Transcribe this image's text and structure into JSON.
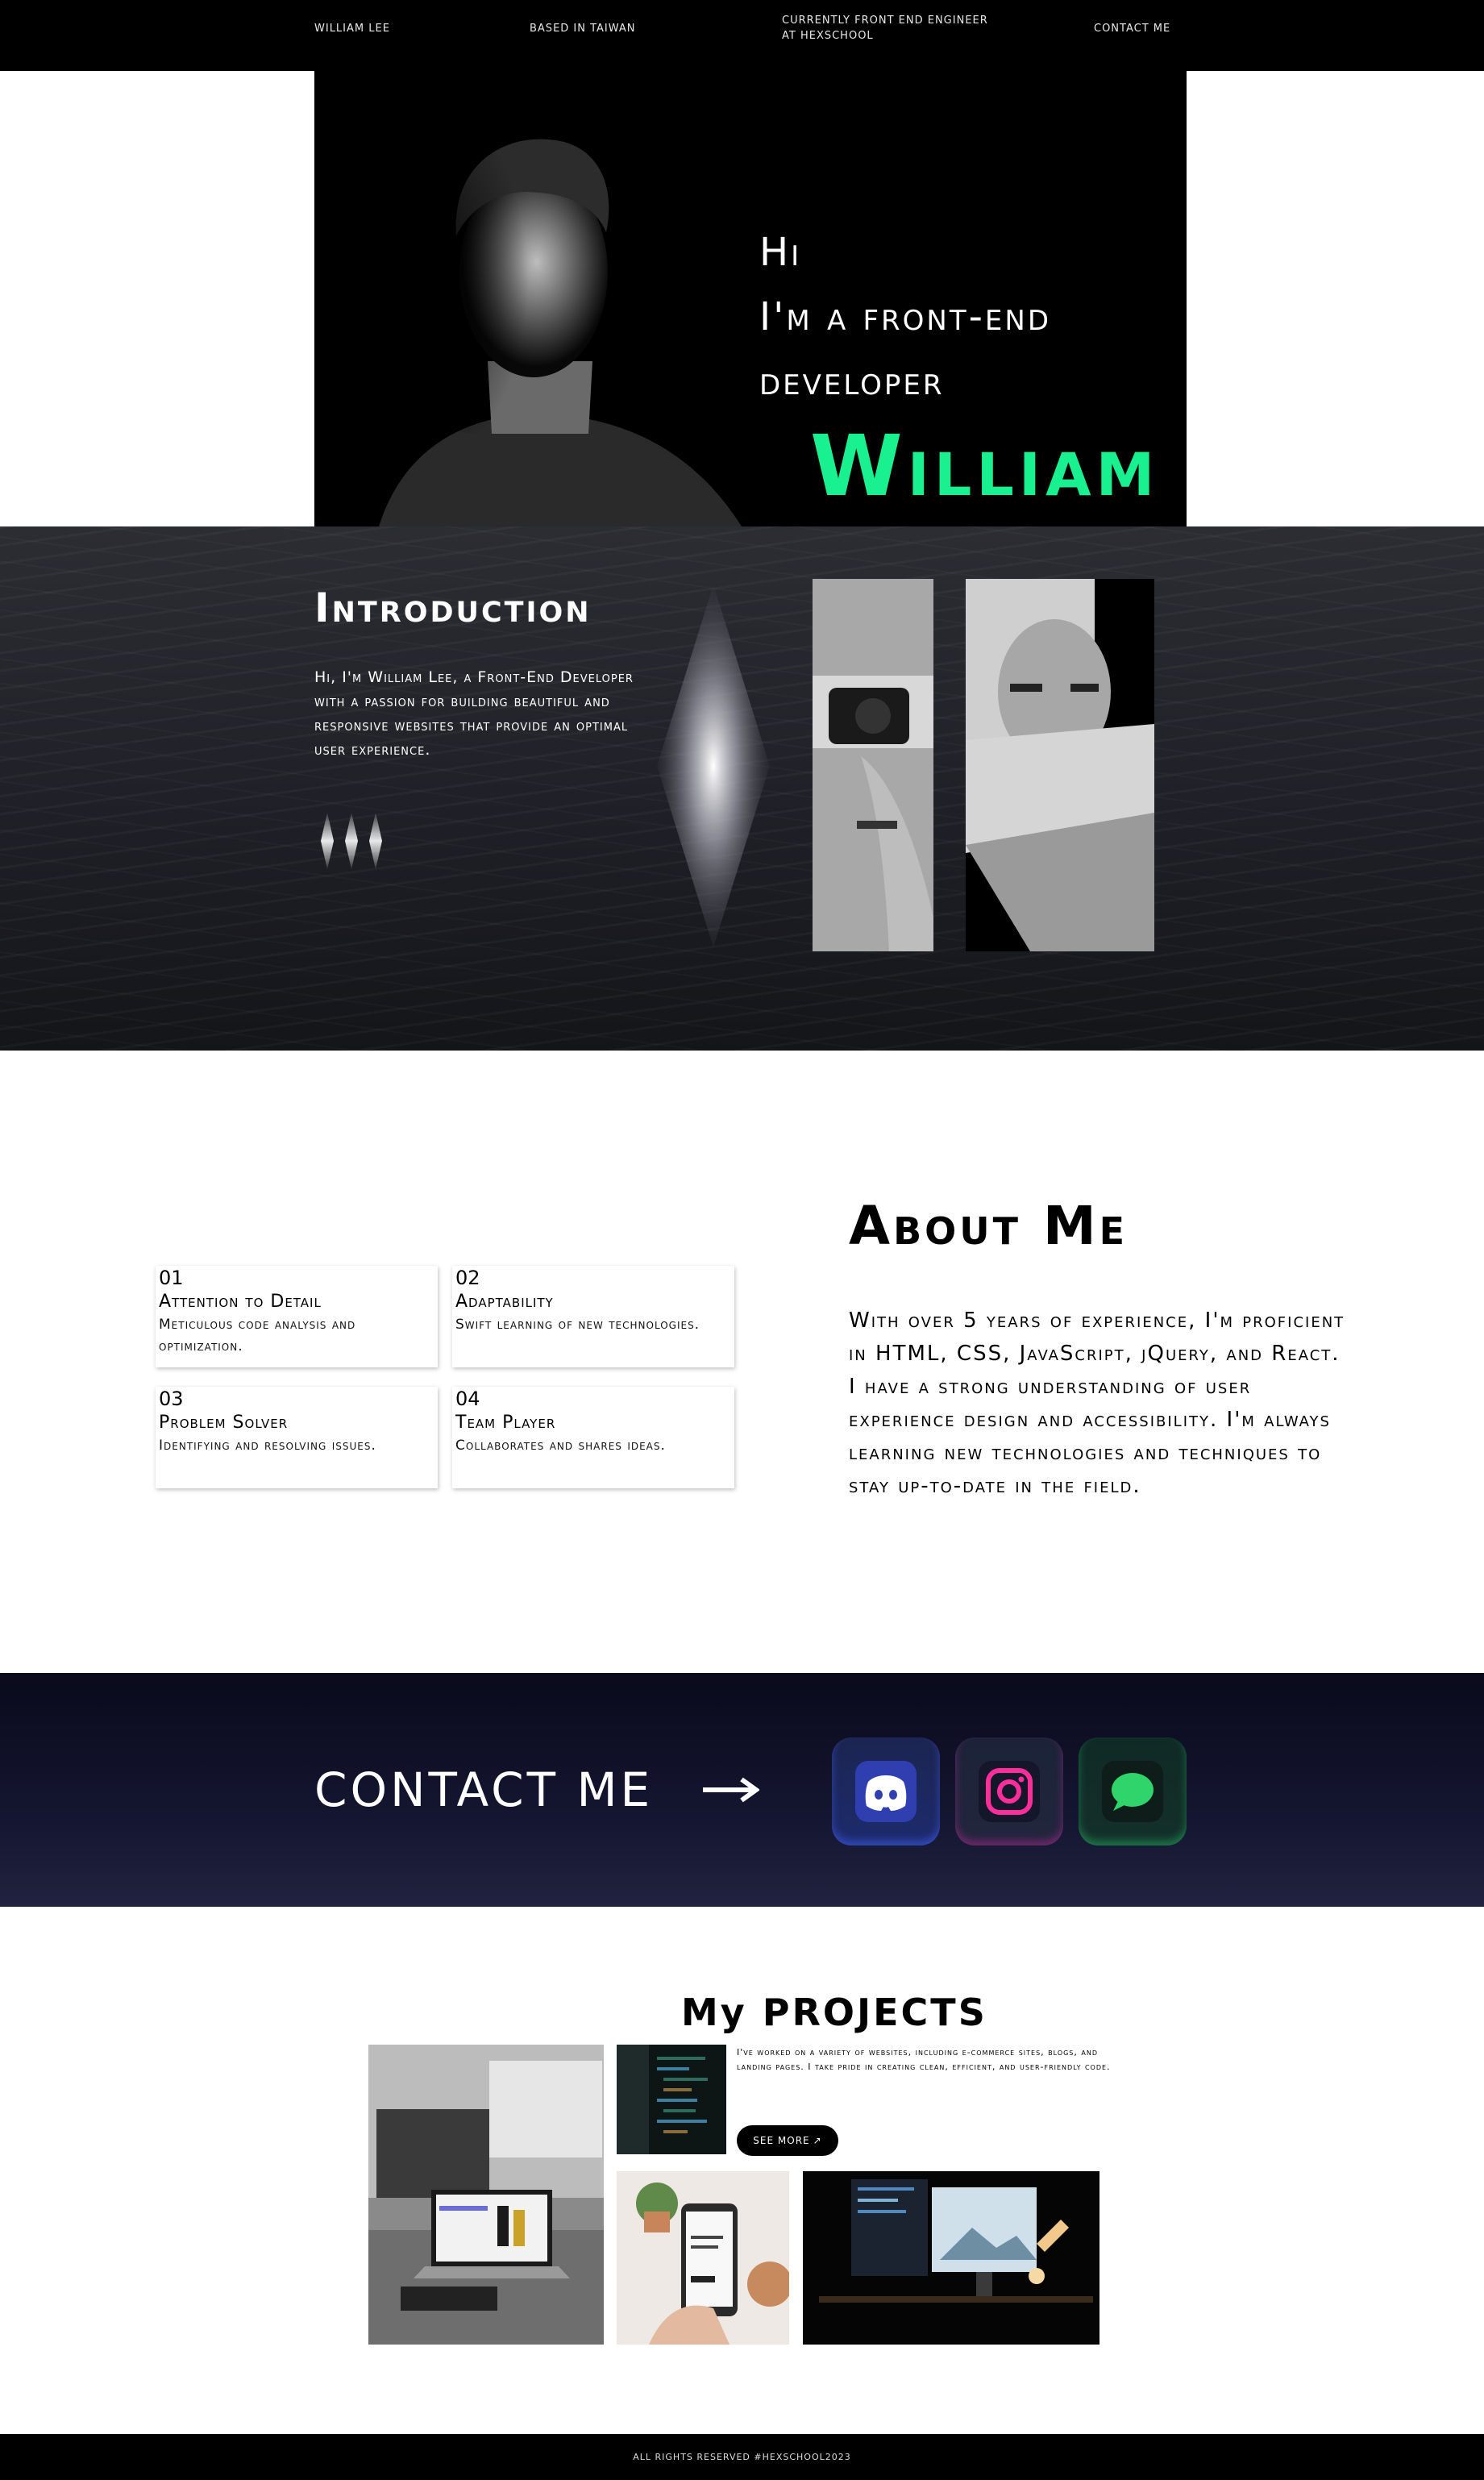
{
  "nav": {
    "name": "WILLIAM LEE",
    "location": "BASED IN TAIWAN",
    "role": "CURRENTLY FRONT END ENGINEER AT HEXSCHOOL",
    "contact": "CONTACT ME"
  },
  "hero": {
    "line1": "Hi",
    "line2": "I'm a front-end",
    "line3": "developer",
    "name": "William",
    "accent_color": "#19f08f"
  },
  "intro": {
    "title": "Introduction",
    "body": "Hi, I'm William Lee, a Front-End Developer with a passion for building beautiful and responsive websites that provide an optimal user experience."
  },
  "about": {
    "title": "About Me",
    "body": "With over 5 years of experience, I'm proficient in HTML, CSS, JavaScript, jQuery, and React. I have a strong understanding of user experience design and accessibility. I'm always learning new technologies and techniques to stay up-to-date in the field.",
    "cards": [
      {
        "num": "01",
        "title": "Attention to Detail",
        "desc": "Meticulous code analysis and optimization."
      },
      {
        "num": "02",
        "title": "Adaptability",
        "desc": "Swift learning of new technologies."
      },
      {
        "num": "03",
        "title": "Problem Solver",
        "desc": "Identifying and resolving issues."
      },
      {
        "num": "04",
        "title": "Team Player",
        "desc": "Collaborates and shares ideas."
      }
    ]
  },
  "contact": {
    "label": "CONTACT ME",
    "icons": [
      "discord-icon",
      "instagram-icon",
      "message-icon"
    ]
  },
  "projects": {
    "title": "My PROJECTS",
    "desc": "I've worked on a variety of websites, including e-commerce sites, blogs, and landing pages. I take pride in creating clean, efficient, and user-friendly code.",
    "see_more": "SEE MORE",
    "see_more_arrow": "↗"
  },
  "footer": {
    "text": "ALL RIGHTS RESERVED #HEXSCHOOL2023"
  }
}
